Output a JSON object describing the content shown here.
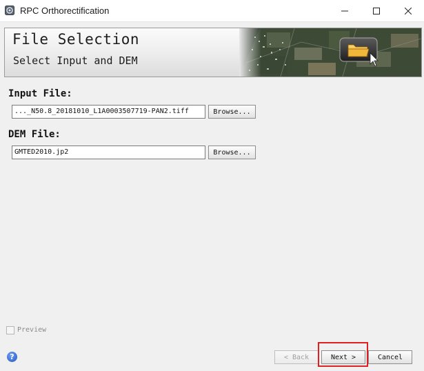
{
  "window": {
    "title": "RPC Orthorectification",
    "minimize_glyph": "—",
    "maximize_glyph": "☐",
    "close_glyph": "✕"
  },
  "banner": {
    "title": "File Selection",
    "subtitle": "Select Input and DEM"
  },
  "input_file": {
    "label": "Input File:",
    "value": "..._N50.8_20181010_L1A0003507719-PAN2.tiff",
    "browse_label": "Browse..."
  },
  "dem_file": {
    "label": "DEM File:",
    "value": "GMTED2010.jp2",
    "browse_label": "Browse..."
  },
  "preview": {
    "label": "Preview",
    "checked": false,
    "enabled": false
  },
  "footer": {
    "help_glyph": "?",
    "back_label": "< Back",
    "next_label": "Next >",
    "cancel_label": "Cancel"
  },
  "colors": {
    "highlight": "#e02020",
    "help": "#2456c4"
  }
}
